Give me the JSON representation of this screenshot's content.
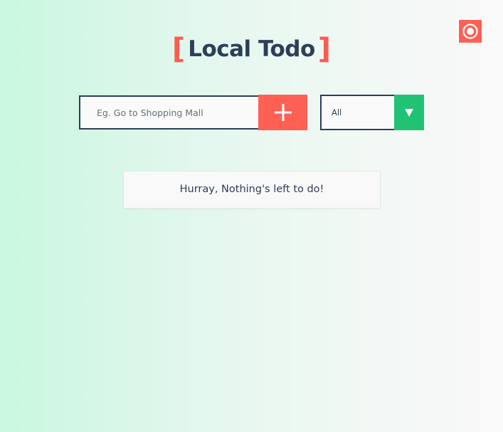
{
  "theme_toggle": {
    "icon": "radio-button-icon",
    "color": "#ff6054"
  },
  "header": {
    "bracket_open": "[",
    "title": "Local Todo",
    "bracket_close": "]",
    "bracket_color": "#ff5c4f",
    "title_color": "#2b3f57"
  },
  "todo_form": {
    "placeholder": "Eg. Go to Shopping Mall",
    "value": "",
    "add_icon": "plus-icon",
    "add_color": "#ff6054"
  },
  "filter": {
    "selected": "All",
    "arrow_icon": "caret-down-icon",
    "arrow_color": "#22c274"
  },
  "todo_list": {
    "items": [],
    "empty_message": "Hurray, Nothing's left to do!"
  }
}
